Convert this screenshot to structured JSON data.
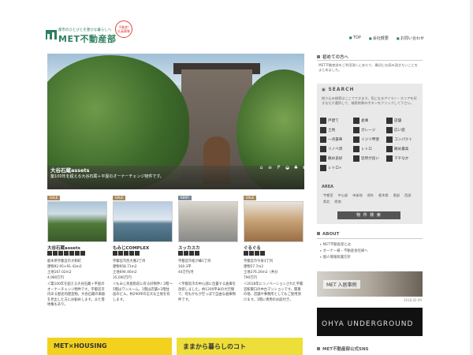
{
  "header": {
    "tagline": "都市のひとびとを豊かな暮らしへ",
    "logo": "MET不動産部",
    "stamp_lines": [
      "不動産!",
      "社員募集"
    ],
    "nav": [
      "TOP",
      "会社概要",
      "お問い合わせ"
    ]
  },
  "hero": {
    "title": "大谷石蔵assets",
    "subtitle": "築100年を超える大谷石蔵＋平屋のオーナーチェンジ物件です。",
    "icons": [
      "house-icon",
      "layers-icon",
      "parking-icon",
      "bath-icon",
      "leaf-icon",
      "pet-icon"
    ]
  },
  "cards": [
    {
      "label": "SALE",
      "name": "大谷石蔵assets",
      "specs": [
        "栃木県宇都宮市大和町",
        "建物92.95+91.43m2",
        "土地167.02m2",
        "4,980万円"
      ],
      "desc": "＜築100年を超える大谷石蔵＋平屋のオーナーチェンジ物件です。宇都宮市内ある歴史的建造物。大谷石蔵の価値を見出した方にお勧めします。また借地権もあり。"
    },
    {
      "label": "SALE",
      "name": "もみじCOMPLEX",
      "specs": [
        "宇都宮市西大寛2丁目",
        "建物958.71m2",
        "土地694.46m2",
        "35,000万円"
      ],
      "desc": "＜もみじ茶屋街前に有る好物件♪ 2階〜5階はワンルーム。1階は店舗+2階住居のビル。約290坪の広大な土地を有します。"
    },
    {
      "label": "RENT",
      "name": "スッカスカ",
      "specs": [
        "宇都宮市松が峰1丁目",
        "160.3平",
        "44万円/月",
        ""
      ],
      "desc": "＜宇都宮市の中心部に位置する倉庫を改装しました。約1200平米の大空間で、何もかもが空っぽで自由な倉庫物件です。"
    },
    {
      "label": "SALE",
      "name": "ぐるぐる",
      "specs": [
        "宇都宮市今泉3丁目",
        "建物57.7m2",
        "土地276.26m2（共分",
        "790万円"
      ],
      "desc": "＜2018年にリノベーションされた宇都宮駅東口の中古マンションです。関東の他、店舗や事務所としてもご使用頂けます。1階に専用のお庭付き。"
    }
  ],
  "banners": [
    "MET×HOUSING",
    "ままから暮らしのコト"
  ],
  "sidebar": {
    "welcome_title": "初めての方へ",
    "welcome_text": "MET不動産部をご利用頂くにあたり、最初にお読み頂きたいことをまとめました。",
    "search_title": "SEARCH",
    "search_text": "絞り込み検索はここでできます。気になるアイコン・エリアを好きなだけ選択して、検索結果のボタンをクリックして下さい。",
    "tags": [
      "戸建て",
      "倉庫",
      "店舗",
      "土地",
      "ガレージ",
      "広い庭",
      "一点豪華",
      "イジリ甲斐",
      "コンパクト",
      "リノベ済",
      "レトロ",
      "眺め最高",
      "眺め良好",
      "近所が良い",
      "マチなか",
      "レトロ+"
    ],
    "area_title": "AREA",
    "areas": [
      "宇都宮",
      "中心部",
      "市街地",
      "郊外",
      "栃木県",
      "東部",
      "西部",
      "県北",
      "県南"
    ],
    "search_button": "物 件 検 索",
    "about_title": "ABOUT",
    "about_links": [
      "MET不動産部とは",
      "オーナー様・不動産会社様へ",
      "個人情報保護方針"
    ],
    "banner1": "MET 入居事例",
    "banner1_date": "2018.02.09",
    "banner2": "OHYA UNDERGROUND",
    "sns_title": "MET不動産部公式SNS"
  }
}
